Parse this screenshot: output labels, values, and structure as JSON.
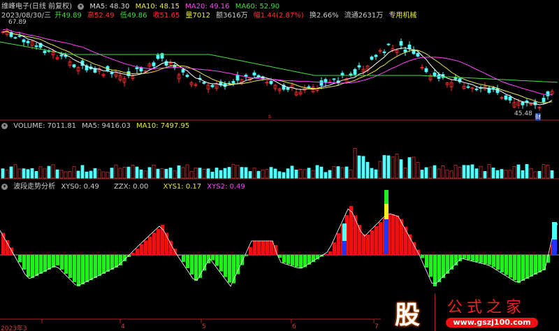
{
  "header": {
    "title": "维峰电子(日线 前复权)",
    "ma5": "MA5: 48.30",
    "ma10": "MA10: 48.15",
    "ma20": "MA20: 49.16",
    "ma60": "MA60: 52.90"
  },
  "quote": {
    "date": "2023/08/30/三",
    "open": "开49.89",
    "high": "高52.49",
    "low": "低49.86",
    "close": "收51.65",
    "vol": "量7012",
    "amount": "额3616万",
    "change": "幅1.44(2.87%)",
    "turnover": "换2.66%",
    "float": "流通2631万",
    "sector": "专用机械"
  },
  "price_labels": {
    "high": "67.89",
    "low": "45.48",
    "marker_s": "s",
    "marker_cai": "财"
  },
  "volume": {
    "label": "VOLUME: 7011.81",
    "ma5": "MA5: 9416.03",
    "ma10": "MA10: 7497.95"
  },
  "indicator": {
    "name": "波段走势分析",
    "xys0": "XYS0: 0.49",
    "zzx": "ZZX: 0.00",
    "xys1": "XYS1: 0.17",
    "xys2": "XYS2: 0.49"
  },
  "axis": {
    "labels": [
      "2023年3",
      "4",
      "5",
      "6",
      "7"
    ]
  },
  "watermark": {
    "char": "股",
    "name": "公式之家",
    "url": "www.gszj100.com"
  },
  "colors": {
    "up": "#ff3232",
    "down": "#54ffff",
    "ma5": "#ffffff",
    "ma10": "#e8e84a",
    "ma20": "#ff44ff",
    "ma60": "#44dd44"
  }
}
